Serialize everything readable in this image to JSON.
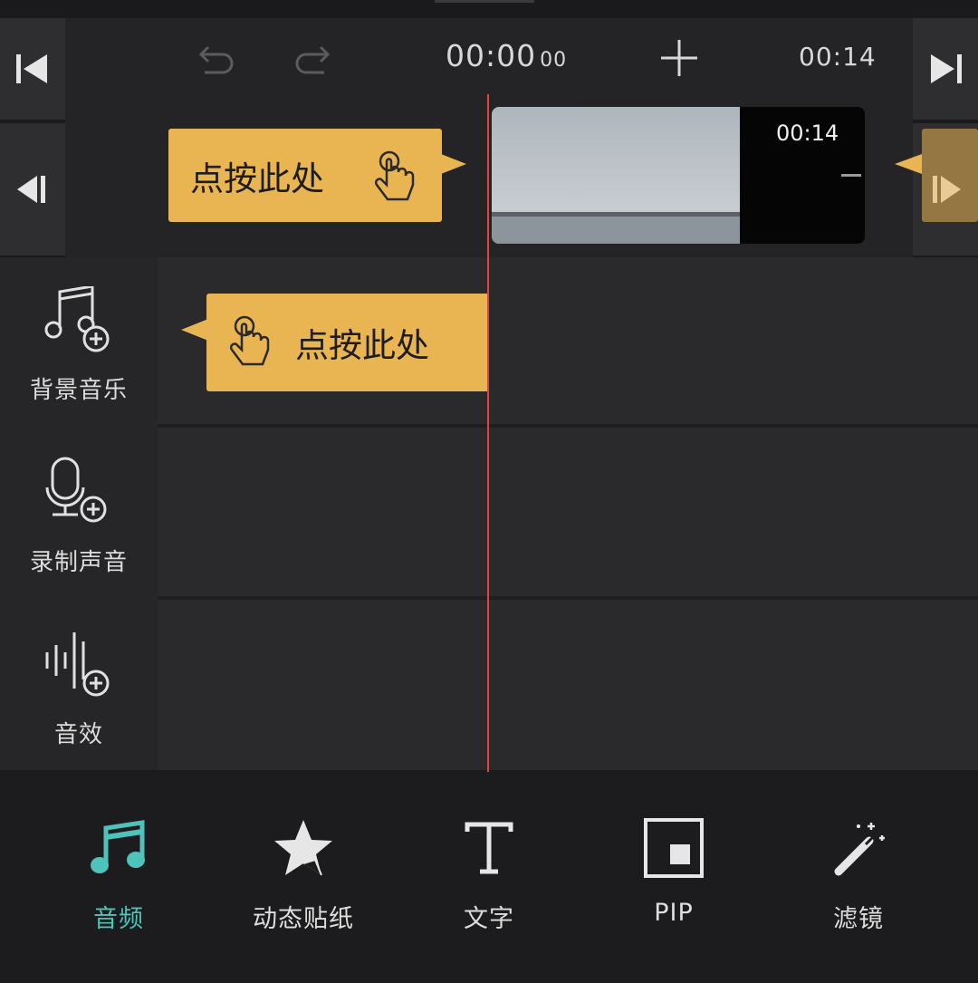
{
  "timeline_header": {
    "current_time": "00:00",
    "current_time_ms": "00",
    "total_time": "00:14"
  },
  "clip": {
    "duration": "00:14"
  },
  "tooltips": {
    "video_tip": "点按此处",
    "audio_tip": "点按此处"
  },
  "track_menu": {
    "items": [
      {
        "label": "背景音乐",
        "icon": "music-note-add-icon"
      },
      {
        "label": "录制声音",
        "icon": "microphone-add-icon"
      },
      {
        "label": "音效",
        "icon": "sound-wave-add-icon"
      }
    ]
  },
  "toolbar": {
    "items": [
      {
        "label": "音频",
        "icon": "music-icon",
        "active": true
      },
      {
        "label": "动态贴纸",
        "icon": "star-sticker-icon",
        "active": false
      },
      {
        "label": "文字",
        "icon": "text-icon",
        "active": false
      },
      {
        "label": "PIP",
        "icon": "pip-icon",
        "active": false
      },
      {
        "label": "滤镜",
        "icon": "magic-wand-icon",
        "active": false
      }
    ]
  },
  "colors": {
    "accent": "#4fc2bb",
    "tooltip": "#e9b452",
    "playhead": "#e0453a"
  }
}
